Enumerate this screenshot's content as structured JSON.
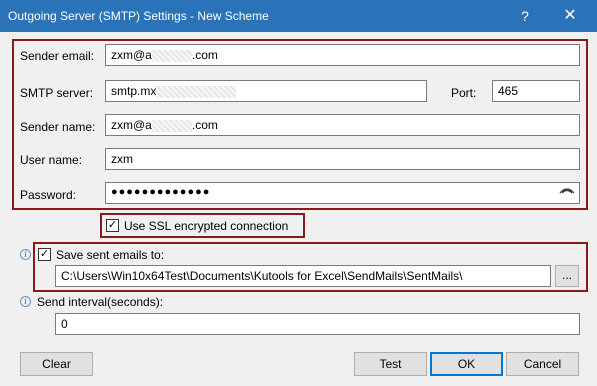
{
  "window": {
    "title": "Outgoing Server (SMTP) Settings - New Scheme",
    "help_label": "?",
    "close_label": "✕"
  },
  "form": {
    "sender_email": {
      "label": "Sender email:",
      "value_prefix": "zxm@a",
      "value_suffix": ".com"
    },
    "smtp_server": {
      "label": "SMTP server:",
      "value_prefix": "smtp.mx"
    },
    "port": {
      "label": "Port:",
      "value": "465"
    },
    "sender_name": {
      "label": "Sender name:",
      "value_prefix": "zxm@a",
      "value_suffix": ".com"
    },
    "user_name": {
      "label": "User name:",
      "value": "zxm"
    },
    "password": {
      "label": "Password:",
      "value": "●●●●●●●●●●●●●"
    },
    "use_ssl": {
      "label": "Use SSL encrypted connection",
      "checked": true
    },
    "save_sent": {
      "label": "Save sent emails to:",
      "checked": true,
      "path": "C:\\Users\\Win10x64Test\\Documents\\Kutools for Excel\\SendMails\\SentMails\\",
      "browse_label": "..."
    },
    "send_interval": {
      "label": "Send interval(seconds):",
      "value": "0"
    }
  },
  "buttons": {
    "clear": "Clear",
    "test": "Test",
    "ok": "OK",
    "cancel": "Cancel"
  },
  "colors": {
    "title_bar": "#2b73b8",
    "highlight_box": "#8b1a1a"
  }
}
